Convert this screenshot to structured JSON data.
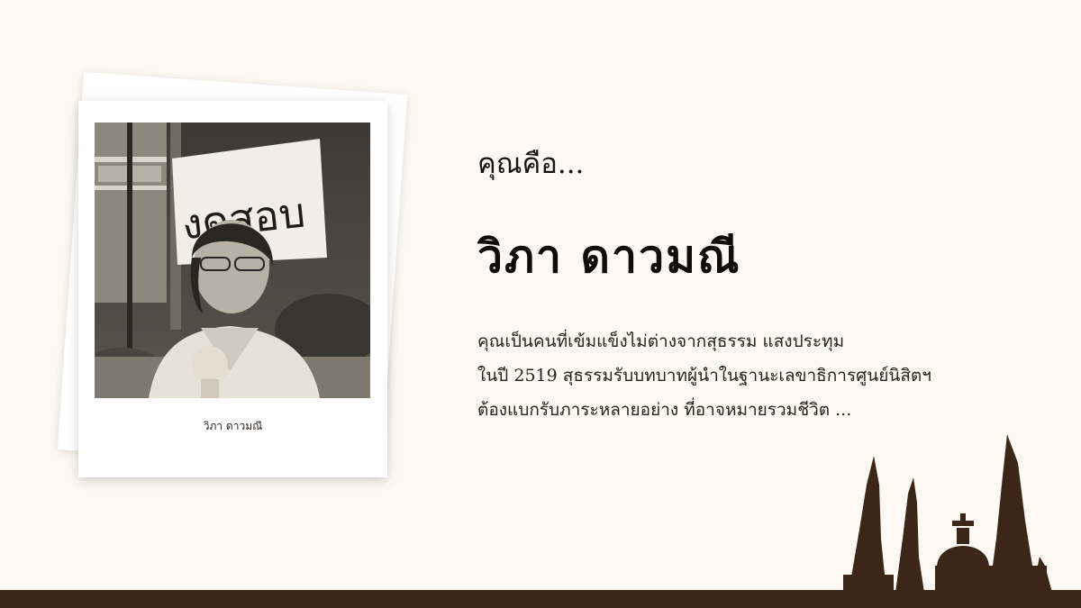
{
  "profile": {
    "caption": "วิภา ดาวมณี",
    "photo_sign_text": "งดสอบ"
  },
  "result": {
    "intro": "คุณคือ...",
    "name": "วิภา  ดาวมณี",
    "description_lines": [
      "คุณเป็นคนที่เข้มแข็งไม่ต่างจากสุธรรม แสงประทุม",
      "ในปี 2519 สุธรรมรับบทบาทผู้นำในฐานะเลขาธิการศูนย์นิสิตฯ",
      "ต้องแบกรับภาระหลายอย่าง ที่อาจหมายรวมชีวิต ..."
    ]
  },
  "colors": {
    "background": "#fbf9f1",
    "ground": "#3b2618",
    "monument": "#3b2618",
    "text": "#1b1410"
  },
  "icons": {
    "monument": "democracy-monument-silhouette"
  }
}
